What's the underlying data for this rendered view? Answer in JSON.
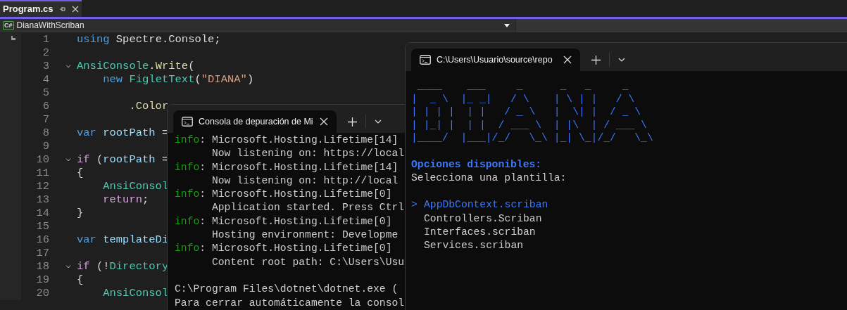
{
  "editor": {
    "tabs": [
      {
        "label": "Program.cs",
        "selected": true
      }
    ],
    "navbar": {
      "project": "DianaWithScriban",
      "language_badge": "C#"
    },
    "lines": [
      {
        "number": "1",
        "fold": false,
        "tokens": [
          {
            "t": "using",
            "kind": "kw"
          },
          {
            "t": " Spectre.Console;",
            "kind": "plain"
          }
        ]
      },
      {
        "number": "2",
        "fold": false
      },
      {
        "number": "3",
        "fold": true,
        "tokens": [
          {
            "t": "AnsiConsole",
            "kind": "type"
          },
          {
            "t": ".",
            "kind": "plain"
          },
          {
            "t": "Write",
            "kind": "method"
          },
          {
            "t": "(",
            "kind": "plain"
          }
        ]
      },
      {
        "number": "4",
        "fold": false,
        "tokens": [
          {
            "t": "    new",
            "kind": "kw"
          },
          {
            "t": " FigletText",
            "kind": "type"
          },
          {
            "t": "(",
            "kind": "plain"
          },
          {
            "t": "\"DIANA\"",
            "kind": "str"
          },
          {
            "t": ")",
            "kind": "plain"
          }
        ]
      },
      {
        "number": "5",
        "fold": false
      },
      {
        "number": "6",
        "fold": false,
        "tokens": [
          {
            "t": "        .",
            "kind": "plain"
          },
          {
            "t": "Color",
            "kind": "method"
          }
        ]
      },
      {
        "number": "7",
        "fold": false
      },
      {
        "number": "8",
        "fold": false,
        "tokens": [
          {
            "t": "var",
            "kind": "kw"
          },
          {
            "t": " rootPath",
            "kind": "var"
          },
          {
            "t": " =",
            "kind": "plain"
          }
        ]
      },
      {
        "number": "9",
        "fold": false
      },
      {
        "number": "10",
        "fold": true,
        "tokens": [
          {
            "t": "if",
            "kind": "ctrl"
          },
          {
            "t": " (",
            "kind": "plain"
          },
          {
            "t": "rootPath",
            "kind": "var"
          },
          {
            "t": " =",
            "kind": "plain"
          }
        ]
      },
      {
        "number": "11",
        "fold": false,
        "tokens": [
          {
            "t": "{",
            "kind": "plain"
          }
        ]
      },
      {
        "number": "12",
        "fold": false,
        "tokens": [
          {
            "t": "    AnsiConsol",
            "kind": "type"
          }
        ]
      },
      {
        "number": "13",
        "fold": false,
        "tokens": [
          {
            "t": "    return",
            "kind": "ctrl"
          },
          {
            "t": ";",
            "kind": "plain"
          }
        ]
      },
      {
        "number": "14",
        "fold": false,
        "tokens": [
          {
            "t": "}",
            "kind": "plain"
          }
        ]
      },
      {
        "number": "15",
        "fold": false
      },
      {
        "number": "16",
        "fold": false,
        "tokens": [
          {
            "t": "var",
            "kind": "kw"
          },
          {
            "t": " templateDi",
            "kind": "var"
          }
        ]
      },
      {
        "number": "17",
        "fold": false
      },
      {
        "number": "18",
        "fold": true,
        "tokens": [
          {
            "t": "if",
            "kind": "ctrl"
          },
          {
            "t": " (!",
            "kind": "plain"
          },
          {
            "t": "Directory",
            "kind": "type"
          }
        ]
      },
      {
        "number": "19",
        "fold": false,
        "tokens": [
          {
            "t": "{",
            "kind": "plain"
          }
        ]
      },
      {
        "number": "20",
        "fold": false,
        "tokens": [
          {
            "t": "    AnsiConsol",
            "kind": "type"
          }
        ]
      }
    ]
  },
  "debug_console": {
    "tab_title": "Consola de depuración de Mi",
    "lines": [
      {
        "kind": "info",
        "prefix": "info",
        "text": ": Microsoft.Hosting.Lifetime[14]"
      },
      {
        "kind": "plain",
        "text": "      Now listening on: https://local"
      },
      {
        "kind": "info",
        "prefix": "info",
        "text": ": Microsoft.Hosting.Lifetime[14]"
      },
      {
        "kind": "plain",
        "text": "      Now listening on: http://local"
      },
      {
        "kind": "info",
        "prefix": "info",
        "text": ": Microsoft.Hosting.Lifetime[0]"
      },
      {
        "kind": "plain",
        "text": "      Application started. Press Ctrl"
      },
      {
        "kind": "info",
        "prefix": "info",
        "text": ": Microsoft.Hosting.Lifetime[0]"
      },
      {
        "kind": "plain",
        "text": "      Hosting environment: Developme"
      },
      {
        "kind": "info",
        "prefix": "info",
        "text": ": Microsoft.Hosting.Lifetime[0]"
      },
      {
        "kind": "plain",
        "text": "      Content root path: C:\\Users\\Usu"
      },
      {
        "kind": "blank"
      },
      {
        "kind": "plain",
        "text": "C:\\Program Files\\dotnet\\dotnet.exe ("
      },
      {
        "kind": "plain",
        "text": "Para cerrar automáticamente la consol"
      }
    ]
  },
  "app_console": {
    "tab_title": "C:\\Users\\Usuario\\source\\repo",
    "figlet": [
      " ____    ___     _      _   _     _",
      "|  _ \\  |_ _|   / \\    | \\ | |   / \\",
      "| | | |  | |   / _ \\   |  \\| |  / _ \\",
      "| |_| |  | |  / ___ \\  | |\\  | / ___ \\",
      "|____/  |___|/_/   \\_\\ |_| \\_|/_/   \\_\\"
    ],
    "heading": "Opciones disponibles:",
    "prompt": "Selecciona una plantilla:",
    "pointer": ">",
    "options": [
      {
        "label": "AppDbContext.scriban",
        "selected": true
      },
      {
        "label": "Controllers.Scriban",
        "selected": false
      },
      {
        "label": "Interfaces.scriban",
        "selected": false
      },
      {
        "label": "Services.scriban",
        "selected": false
      }
    ]
  }
}
